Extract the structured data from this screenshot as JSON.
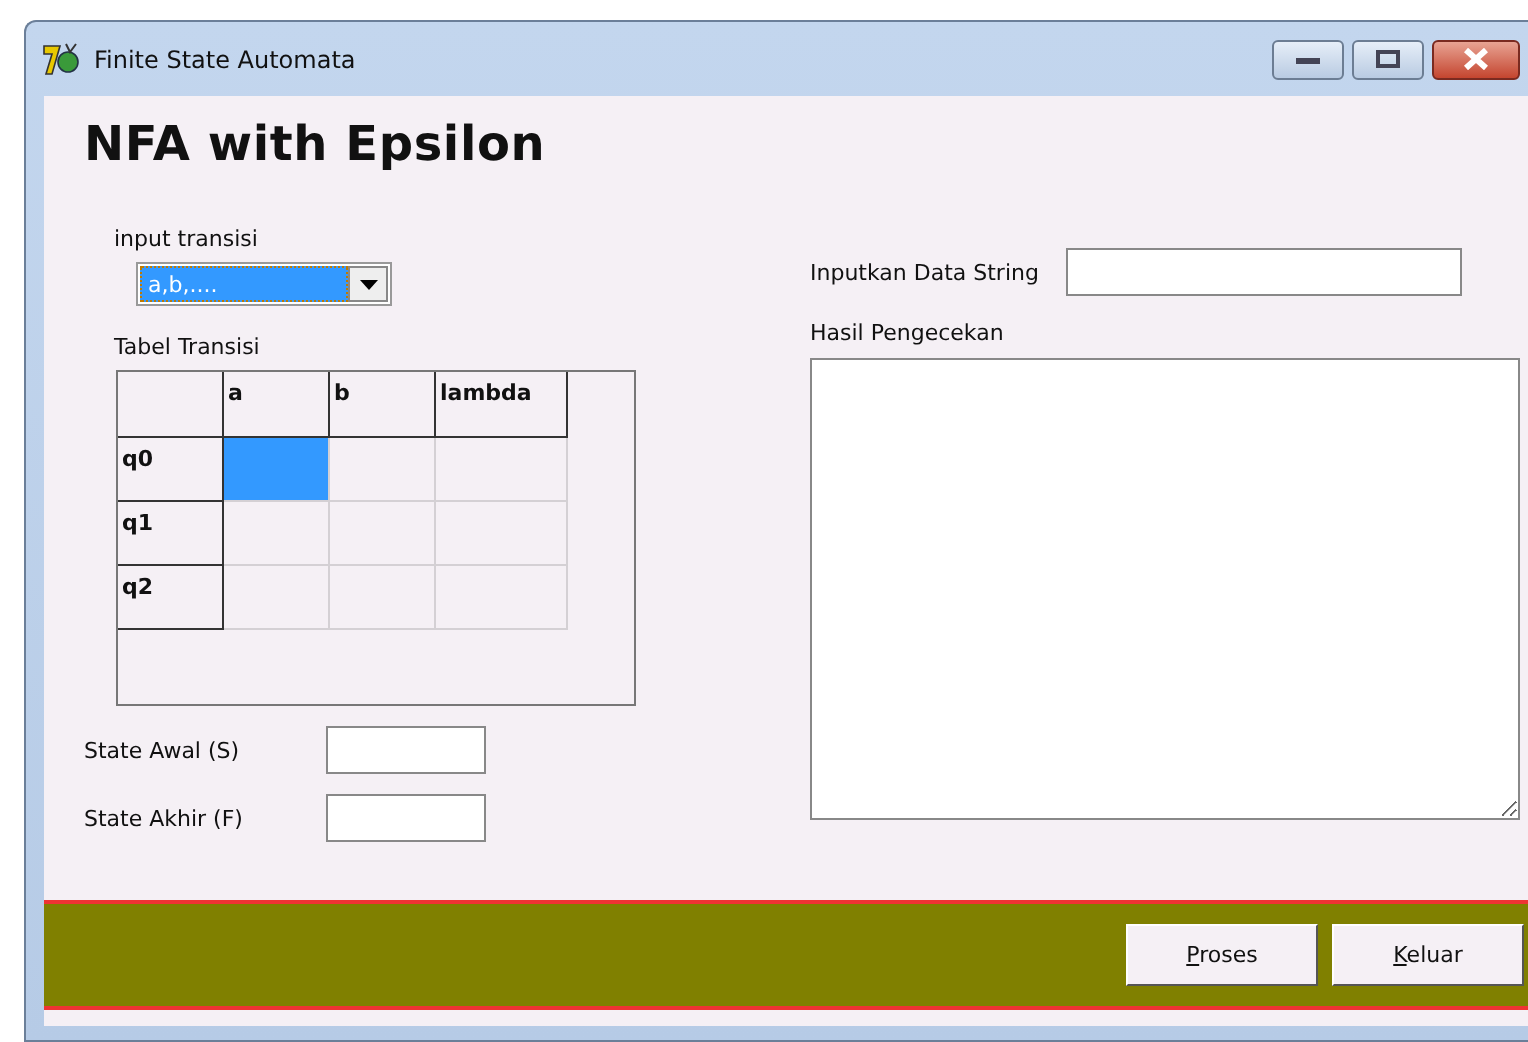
{
  "window": {
    "title": "Finite State Automata"
  },
  "heading": "NFA with Epsilon",
  "input_transisi": {
    "label": "input transisi",
    "value": "a,b,....",
    "selected": true
  },
  "tabel_transisi": {
    "label": "Tabel Transisi",
    "columns": [
      "a",
      "b",
      "lambda"
    ],
    "rows": [
      {
        "state": "q0",
        "cells": [
          {
            "selected": true
          },
          {
            "selected": false
          },
          {
            "selected": false
          }
        ]
      },
      {
        "state": "q1",
        "cells": [
          {
            "selected": false
          },
          {
            "selected": false
          },
          {
            "selected": false
          }
        ]
      },
      {
        "state": "q2",
        "cells": [
          {
            "selected": false
          },
          {
            "selected": false
          },
          {
            "selected": false
          }
        ]
      }
    ]
  },
  "state_awal": {
    "label": "State Awal (S)"
  },
  "state_akhir": {
    "label": "State Akhir (F)"
  },
  "data_string": {
    "label": "Inputkan Data String"
  },
  "hasil": {
    "label": "Hasil Pengecekan"
  },
  "buttons": [
    {
      "label": "Proses",
      "first_letter_underlined": true
    },
    {
      "label": "Keluar",
      "first_letter_underlined": true
    }
  ]
}
